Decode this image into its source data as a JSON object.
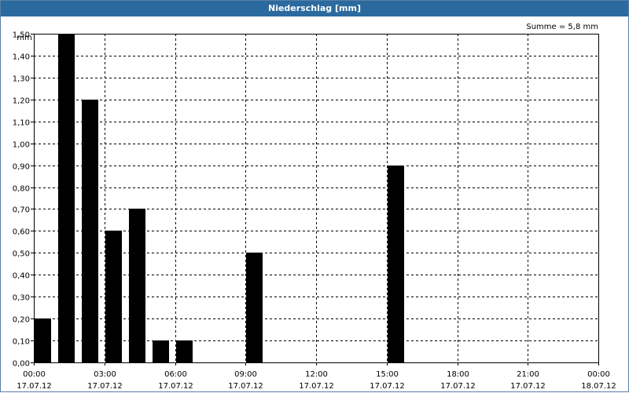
{
  "window": {
    "title": "Niederschlag [mm]"
  },
  "chart_data": {
    "type": "bar",
    "title": "Niederschlag [mm]",
    "summary_text": "Summe = 5,8 mm",
    "ylabel": "mm",
    "ylim": [
      0,
      1.5
    ],
    "yticks": [
      "0,00",
      "0,10",
      "0,20",
      "0,30",
      "0,40",
      "0,50",
      "0,60",
      "0,70",
      "0,80",
      "0,90",
      "1,00",
      "1,10",
      "1,20",
      "1,30",
      "1,40",
      "1,50"
    ],
    "xlim_hours": [
      0,
      24
    ],
    "xticks": [
      {
        "hour": 0,
        "time": "00:00",
        "date": "17.07.12"
      },
      {
        "hour": 3,
        "time": "03:00",
        "date": "17.07.12"
      },
      {
        "hour": 6,
        "time": "06:00",
        "date": "17.07.12"
      },
      {
        "hour": 9,
        "time": "09:00",
        "date": "17.07.12"
      },
      {
        "hour": 12,
        "time": "12:00",
        "date": "17.07.12"
      },
      {
        "hour": 15,
        "time": "15:00",
        "date": "17.07.12"
      },
      {
        "hour": 18,
        "time": "18:00",
        "date": "17.07.12"
      },
      {
        "hour": 21,
        "time": "21:00",
        "date": "17.07.12"
      },
      {
        "hour": 24,
        "time": "00:00",
        "date": "18.07.12"
      }
    ],
    "bars": [
      {
        "hour_start": 0,
        "value": 0.2
      },
      {
        "hour_start": 1,
        "value": 1.5
      },
      {
        "hour_start": 2,
        "value": 1.2
      },
      {
        "hour_start": 3,
        "value": 0.6
      },
      {
        "hour_start": 4,
        "value": 0.7
      },
      {
        "hour_start": 5,
        "value": 0.1
      },
      {
        "hour_start": 6,
        "value": 0.1
      },
      {
        "hour_start": 9,
        "value": 0.5
      },
      {
        "hour_start": 15,
        "value": 0.9
      }
    ],
    "bar_color": "#000000",
    "grid": true,
    "grid_style": "dashed"
  }
}
